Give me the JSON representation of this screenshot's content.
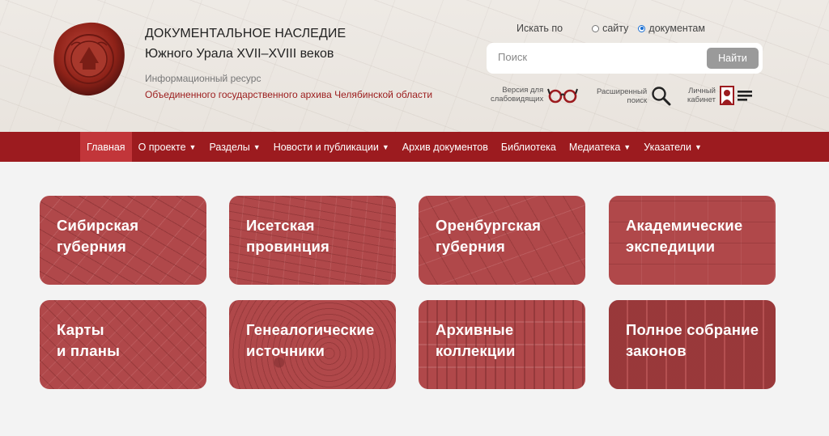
{
  "header": {
    "title_line1": "ДОКУМЕНТАЛЬНОЕ НАСЛЕДИЕ",
    "title_line2": "Южного Урала XVII–XVIII веков",
    "subtitle1": "Информационный ресурс",
    "subtitle2": "Объединенного государственного архива Челябинской области"
  },
  "search": {
    "scope_label": "Искать по",
    "option_site": "сайту",
    "option_docs": "документам",
    "selected": "документам",
    "placeholder": "Поиск",
    "value": "",
    "button": "Найти"
  },
  "tools": {
    "vision_line1": "Версия для",
    "vision_line2": "слабовидящих",
    "advanced_line1": "Расширенный",
    "advanced_line2": "поиск",
    "cabinet_line1": "Личный",
    "cabinet_line2": "кабинет"
  },
  "nav": [
    {
      "label": "Главная",
      "dropdown": false,
      "active": true
    },
    {
      "label": "О проекте",
      "dropdown": true,
      "active": false
    },
    {
      "label": "Разделы",
      "dropdown": true,
      "active": false
    },
    {
      "label": "Новости и публикации",
      "dropdown": true,
      "active": false
    },
    {
      "label": "Архив документов",
      "dropdown": false,
      "active": false
    },
    {
      "label": "Библиотека",
      "dropdown": false,
      "active": false
    },
    {
      "label": "Медиатека",
      "dropdown": true,
      "active": false
    },
    {
      "label": "Указатели",
      "dropdown": true,
      "active": false
    }
  ],
  "nav_caret": "▼",
  "tiles": [
    {
      "line1": "Сибирская",
      "line2": "губерния"
    },
    {
      "line1": "Исетская",
      "line2": "провинция"
    },
    {
      "line1": "Оренбургская",
      "line2": "губерния"
    },
    {
      "line1": "Академические",
      "line2": "экспедиции"
    },
    {
      "line1": "Карты",
      "line2": "и планы"
    },
    {
      "line1": "Генеалогические",
      "line2": "источники"
    },
    {
      "line1": "Архивные",
      "line2": "коллекции"
    },
    {
      "line1": "Полное собрание",
      "line2": "законов"
    }
  ],
  "colors": {
    "nav_bg": "#9c1b1f",
    "nav_active": "#c2363a",
    "tile_bg": "#b0484a",
    "accent_text": "#9b1c1c"
  }
}
